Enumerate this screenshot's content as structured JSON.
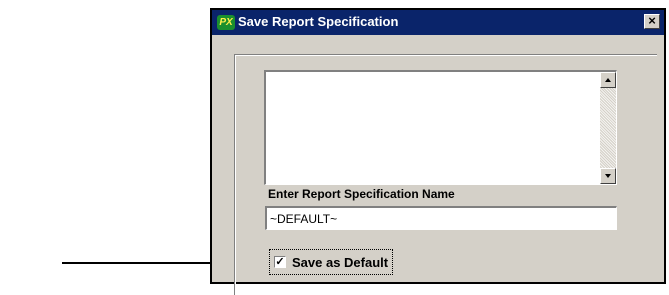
{
  "dialog": {
    "title": "Save Report Specification",
    "app_icon_text": "PX",
    "close_glyph": "×"
  },
  "spec_text": {
    "value": ""
  },
  "name_field": {
    "label": "Enter Report Specification Name",
    "value": "~DEFAULT~"
  },
  "default_option": {
    "label": "Save as Default",
    "checked": true,
    "check_glyph": "✓"
  },
  "icons": [
    "app-icon",
    "close-icon",
    "scroll-up-icon",
    "scroll-down-icon",
    "arrow-pointer"
  ],
  "colors": {
    "titlebar": "#0a246a",
    "dialog_face": "#d4d0c8",
    "input_bg": "#ffffff"
  }
}
